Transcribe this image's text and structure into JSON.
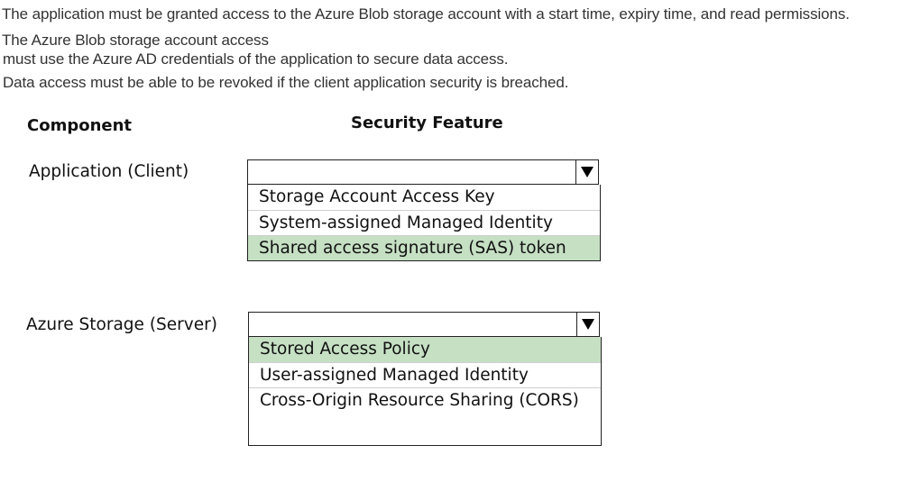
{
  "requirements": [
    "The application must be granted access to the Azure Blob storage account with a start time, expiry time, and read permissions.",
    "The Azure Blob storage account access",
    "must use the Azure AD credentials of the application to secure data access.",
    "Data access must be able to be revoked if the client application security is breached."
  ],
  "table": {
    "component_header": "Component",
    "feature_header": "Security Feature"
  },
  "rows": [
    {
      "component": "Application (Client)",
      "options": [
        {
          "label": "Storage Account Access Key",
          "selected": false
        },
        {
          "label": "System-assigned Managed Identity",
          "selected": false
        },
        {
          "label": "Shared access signature (SAS) token",
          "selected": true
        }
      ]
    },
    {
      "component": "Azure Storage (Server)",
      "options": [
        {
          "label": "Stored Access Policy",
          "selected": true
        },
        {
          "label": "User-assigned Managed Identity",
          "selected": false
        },
        {
          "label": "Cross-Origin Resource Sharing (CORS)",
          "selected": false
        }
      ]
    }
  ],
  "colors": {
    "selected_highlight": "#c6e0c4",
    "border": "#222222"
  },
  "icons": {
    "dropdown": "triangle-down-icon"
  }
}
